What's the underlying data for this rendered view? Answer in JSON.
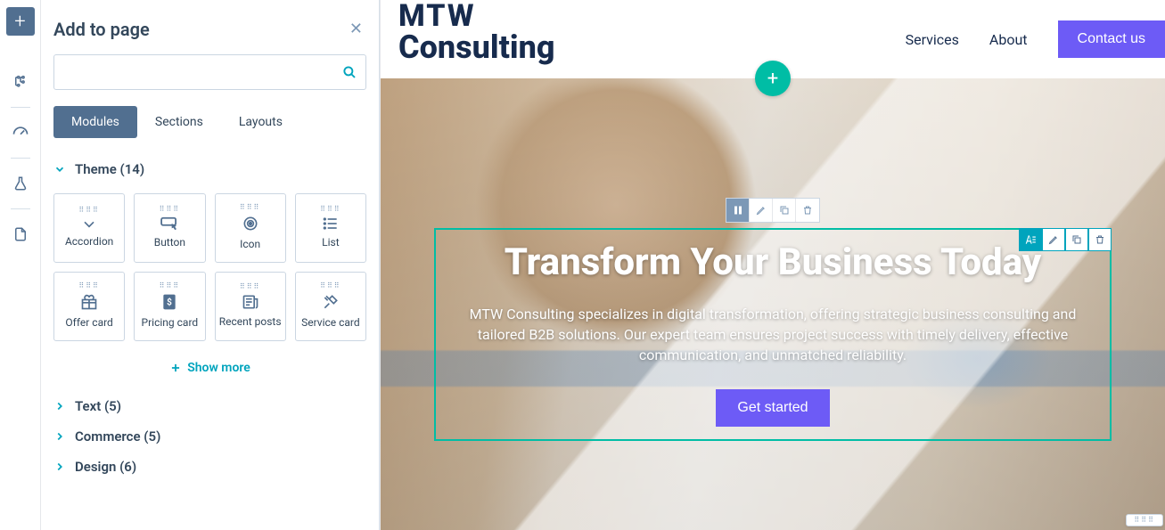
{
  "panel": {
    "title": "Add to page",
    "search_placeholder": "",
    "tabs": {
      "modules": "Modules",
      "sections": "Sections",
      "layouts": "Layouts"
    },
    "categories": {
      "theme": {
        "label": "Theme (14)"
      },
      "text": {
        "label": "Text (5)"
      },
      "commerce": {
        "label": "Commerce (5)"
      },
      "design": {
        "label": "Design (6)"
      }
    },
    "modules": {
      "accordion": "Accordion",
      "button": "Button",
      "icon": "Icon",
      "list": "List",
      "offer_card": "Offer card",
      "pricing_card": "Pricing card",
      "recent_posts": "Recent posts",
      "service_card": "Service card"
    },
    "show_more": "Show more"
  },
  "site": {
    "logo_line1": "MTW",
    "logo_line2": "Consulting",
    "nav": {
      "services": "Services",
      "about": "About",
      "contact": "Contact us"
    }
  },
  "hero": {
    "title": "Transform Your Business Today",
    "text": "MTW Consulting specializes in digital transformation, offering strategic business consulting and tailored B2B solutions. Our expert team ensures project success with timely delivery, effective communication, and unmatched reliability.",
    "cta": "Get started"
  },
  "colors": {
    "primary_cta": "#6d5bf6",
    "accent": "#00a4bd",
    "accent_fab": "#00bda5"
  }
}
